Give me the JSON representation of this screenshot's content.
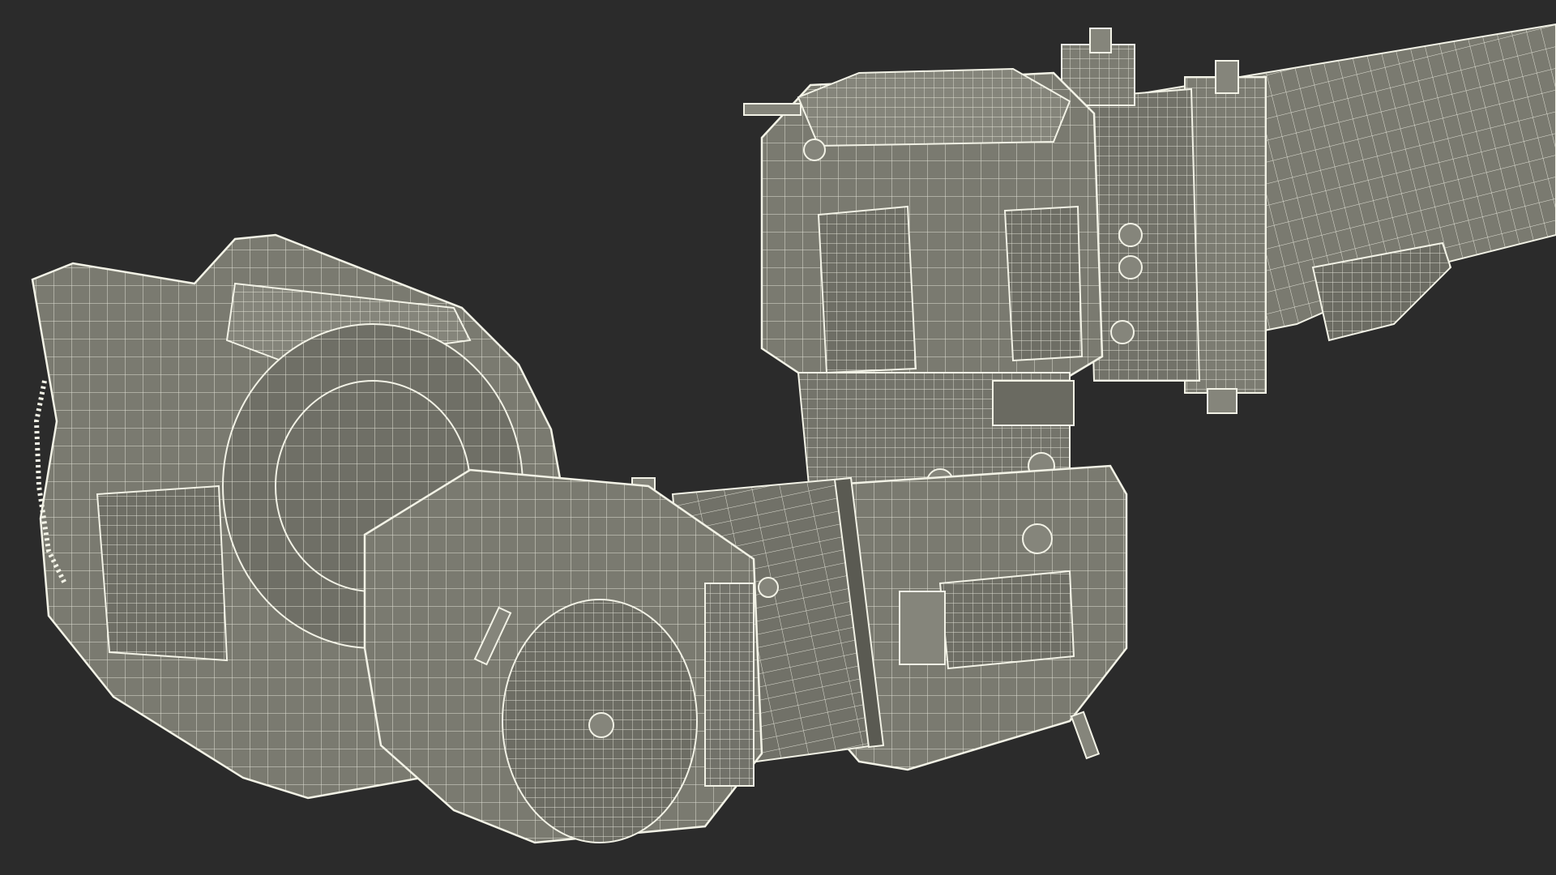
{
  "scene": {
    "background_color": "#2b2b2b",
    "mesh_fill": "#7a7a70",
    "mesh_fill_dark": "#66665d",
    "mesh_fill_light": "#8a8a80",
    "wire_color": "#f2f2e6"
  }
}
